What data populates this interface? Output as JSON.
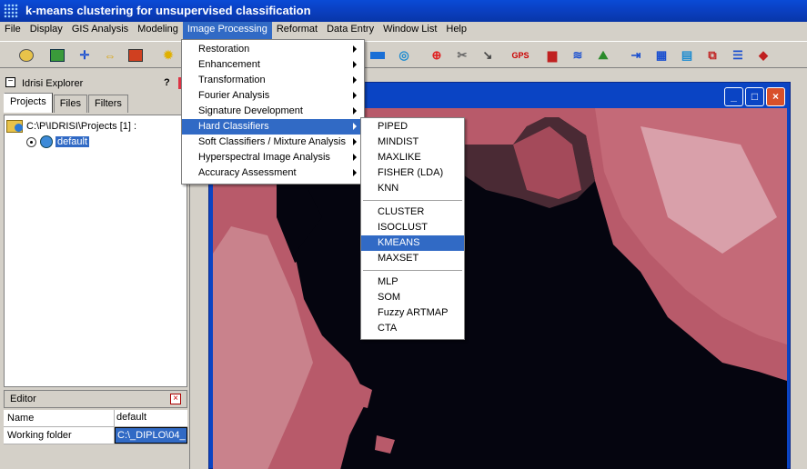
{
  "window": {
    "title": "k-means clustering for unsupervised classification"
  },
  "menubar": {
    "items": [
      "File",
      "Display",
      "GIS Analysis",
      "Modeling",
      "Image Processing",
      "Reformat",
      "Data Entry",
      "Window List",
      "Help"
    ],
    "active": "Image Processing"
  },
  "image_processing_menu": {
    "items": [
      "Restoration",
      "Enhancement",
      "Transformation",
      "Fourier Analysis",
      "Signature Development",
      "Hard Classifiers",
      "Soft Classifiers / Mixture Analysis",
      "Hyperspectral Image Analysis",
      "Accuracy Assessment"
    ],
    "highlighted": "Hard Classifiers"
  },
  "hard_classifiers_menu": {
    "group1": [
      "PIPED",
      "MINDIST",
      "MAXLIKE",
      "FISHER (LDA)",
      "KNN"
    ],
    "group2": [
      "CLUSTER",
      "ISOCLUST",
      "KMEANS",
      "MAXSET"
    ],
    "group3": [
      "MLP",
      "SOM",
      "Fuzzy ARTMAP",
      "CTA"
    ],
    "highlighted": "KMEANS"
  },
  "toolbar": {
    "gps_label": "GPS"
  },
  "explorer": {
    "title": "Idrisi Explorer",
    "help_glyph": "?",
    "close_glyph": "×",
    "minimize_glyph": "−",
    "tabs": [
      "Projects",
      "Files",
      "Filters"
    ],
    "selected_tab": "Projects",
    "tree": {
      "root": "C:\\P\\IDRISI\\Projects [1] :",
      "project": "default"
    }
  },
  "editor": {
    "title": "Editor",
    "close_glyph": "×",
    "rows": [
      {
        "key": "Name",
        "value": "default"
      },
      {
        "key": "Working folder",
        "value": "C:\\_DIPLO\\04_"
      }
    ]
  },
  "image_window": {
    "min_glyph": "_",
    "max_glyph": "□",
    "close_glyph": "×"
  },
  "colors": {
    "selection": "#316ac5",
    "titlebar": "#0a3fc0",
    "water": "#05050f",
    "vegetation": "#c0556b"
  }
}
